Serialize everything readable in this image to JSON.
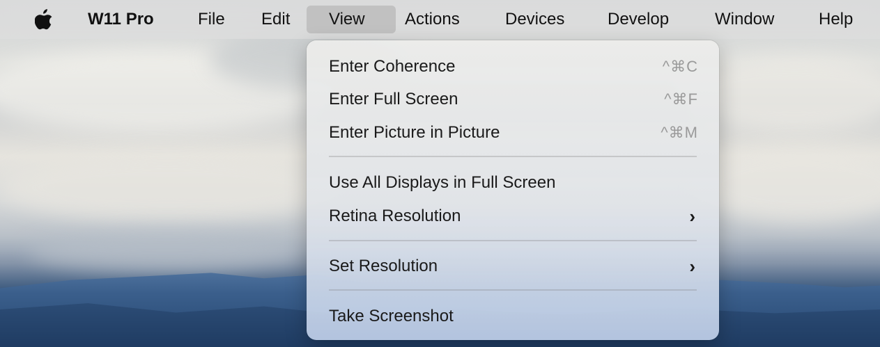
{
  "menubar": {
    "app_name": "W11 Pro",
    "items": [
      "File",
      "Edit",
      "View",
      "Actions",
      "Devices",
      "Develop",
      "Window",
      "Help"
    ],
    "active_item": "View",
    "apple_icon": "apple-logo-icon"
  },
  "view_menu": {
    "groups": [
      [
        {
          "label": "Enter Coherence",
          "shortcut": "^⌘C"
        },
        {
          "label": "Enter Full Screen",
          "shortcut": "^⌘F"
        },
        {
          "label": "Enter Picture in Picture",
          "shortcut": "^⌘M"
        }
      ],
      [
        {
          "label": "Use All Displays in Full Screen"
        },
        {
          "label": "Retina Resolution",
          "submenu_icon": "chevron-right-icon"
        }
      ],
      [
        {
          "label": "Set Resolution",
          "submenu_icon": "chevron-right-icon"
        }
      ],
      [
        {
          "label": "Take Screenshot"
        }
      ]
    ]
  },
  "colors": {
    "menubar_bg": "#dedede",
    "active_menu_bg": "#bebebe",
    "shortcut_text": "#9a9a9a"
  }
}
